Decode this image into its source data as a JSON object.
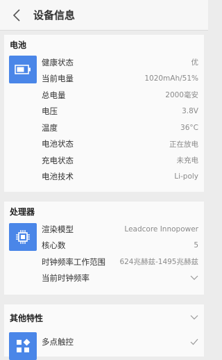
{
  "header": {
    "title": "设备信息"
  },
  "battery": {
    "section_title": "电池",
    "rows": [
      {
        "label": "健康状态",
        "value": "优"
      },
      {
        "label": "当前电量",
        "value": "1020mAh/51%"
      },
      {
        "label": "总电量",
        "value": "2000毫安"
      },
      {
        "label": "电压",
        "value": "3.8V"
      },
      {
        "label": "温度",
        "value": "36°C"
      },
      {
        "label": "电池状态",
        "value": "正在放电"
      },
      {
        "label": "充电状态",
        "value": "未充电"
      },
      {
        "label": "电池技术",
        "value": "Li-poly"
      }
    ]
  },
  "processor": {
    "section_title": "处理器",
    "rows": [
      {
        "label": "渲染模型",
        "value": "Leadcore Innopower"
      },
      {
        "label": "核心数",
        "value": "5"
      },
      {
        "label": "时钟频率工作范围",
        "value": "624兆赫兹-1495兆赫兹"
      },
      {
        "label": "当前时钟频率",
        "value": ""
      }
    ]
  },
  "other": {
    "section_title": "其他特性",
    "rows": [
      {
        "label": "多点触控",
        "value": ""
      }
    ]
  },
  "colors": {
    "tile_blue": "#4a86e8",
    "background": "#ececec"
  }
}
